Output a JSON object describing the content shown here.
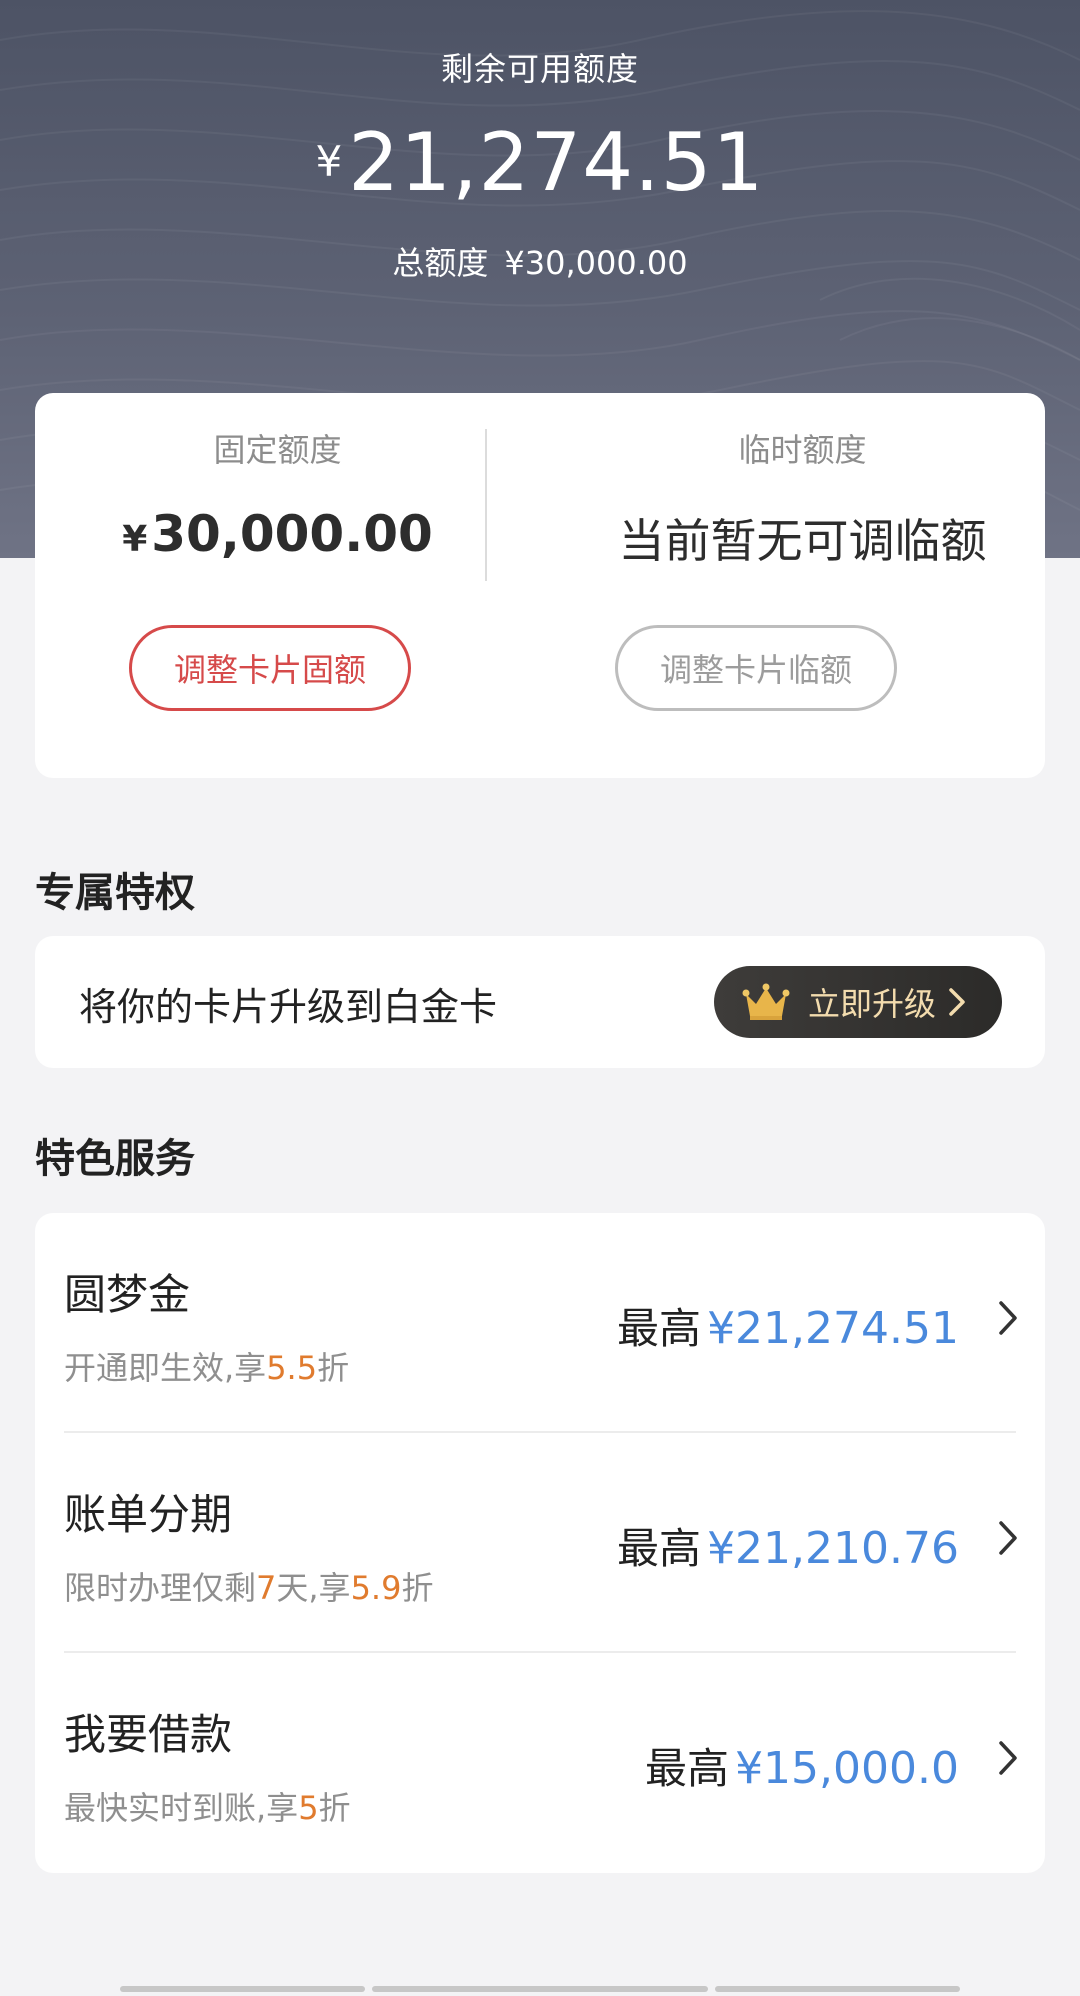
{
  "header": {
    "label": "剩余可用额度",
    "currency": "¥",
    "available": "21,274.51",
    "total_label": "总额度",
    "total_value": "¥30,000.00"
  },
  "credit": {
    "fixed_title": "固定额度",
    "fixed_currency": "¥",
    "fixed_value": "30,000.00",
    "temp_title": "临时额度",
    "temp_note": "当前暂无可调临额",
    "adjust_fixed_button": "调整卡片固额",
    "adjust_temp_button": "调整卡片临额"
  },
  "privilege": {
    "section_title": "专属特权",
    "text": "将你的卡片升级到白金卡",
    "button": "立即升级",
    "icon": "crown-icon"
  },
  "services": {
    "section_title": "特色服务",
    "items": [
      {
        "title": "圆梦金",
        "sub_parts": [
          "开通即生效,享",
          "5.5",
          "折",
          "",
          ""
        ],
        "max_label": "最高",
        "amount": "¥21,274.51"
      },
      {
        "title": "账单分期",
        "sub_parts": [
          "限时办理仅剩",
          "7",
          "天,享",
          "5.9",
          "折"
        ],
        "max_label": "最高",
        "amount": "¥21,210.76"
      },
      {
        "title": "我要借款",
        "sub_parts": [
          "最快实时到账,享",
          "5",
          "折",
          "",
          ""
        ],
        "max_label": "最高",
        "amount": "¥15,000.0"
      }
    ]
  },
  "colors": {
    "accent_red": "#d64a4a",
    "highlight_orange": "#e07b2e",
    "amount_blue": "#4a89dc",
    "gold": "#f3dcae"
  }
}
